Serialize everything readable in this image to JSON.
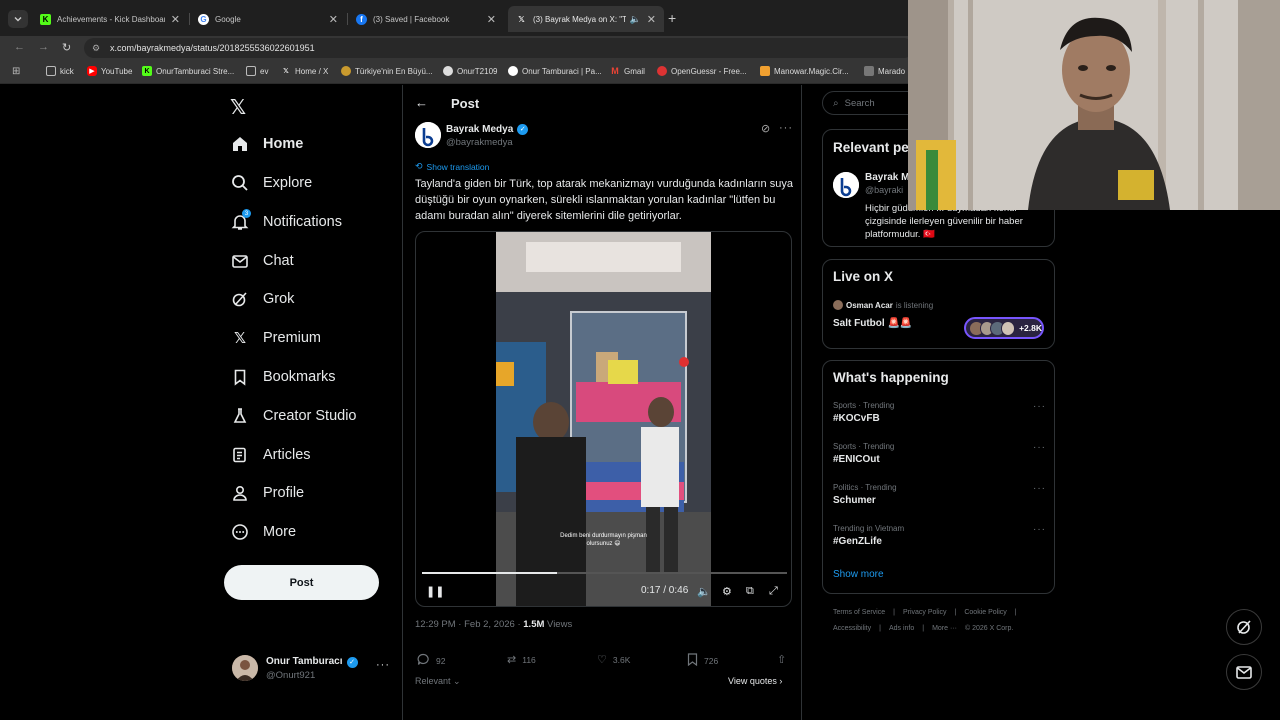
{
  "browser": {
    "tabs": [
      {
        "title": "Achievements - Kick Dashboard",
        "icon": "kick-icon",
        "color": "#53fc18"
      },
      {
        "title": "Google",
        "icon": "google-icon",
        "color": "#4285f4"
      },
      {
        "title": "(3) Saved | Facebook",
        "icon": "facebook-icon",
        "color": "#1877f2"
      },
      {
        "title": "(3) Bayrak Medya on X: \"Ta",
        "icon": "x-icon",
        "color": "#ffffff"
      }
    ],
    "new_tab": "+",
    "url": "x.com/bayrakmedya/status/2018255536022601951",
    "bookmarks": [
      {
        "label": "kick",
        "icon": "folder-icon"
      },
      {
        "label": "YouTube",
        "icon": "youtube-icon"
      },
      {
        "label": "OnurTamburaci Stre...",
        "icon": "kick-icon"
      },
      {
        "label": "ev",
        "icon": "folder-icon"
      },
      {
        "label": "Home / X",
        "icon": "x-icon"
      },
      {
        "label": "Türkiye'nin En Büyü...",
        "icon": "site-icon"
      },
      {
        "label": "OnurT2109",
        "icon": "site-icon"
      },
      {
        "label": "Onur Tamburaci | Pa...",
        "icon": "site-icon"
      },
      {
        "label": "Gmail",
        "icon": "gmail-icon"
      },
      {
        "label": "OpenGuessr - Free...",
        "icon": "site-icon"
      },
      {
        "label": "Manowar.Magic.Cir...",
        "icon": "site-icon"
      },
      {
        "label": "Marado",
        "icon": "site-icon"
      }
    ]
  },
  "nav": {
    "items": [
      {
        "label": "Home",
        "icon": "home-icon"
      },
      {
        "label": "Explore",
        "icon": "search-icon"
      },
      {
        "label": "Notifications",
        "icon": "bell-icon"
      },
      {
        "label": "Chat",
        "icon": "mail-icon"
      },
      {
        "label": "Grok",
        "icon": "grok-icon"
      },
      {
        "label": "Premium",
        "icon": "x-icon"
      },
      {
        "label": "Bookmarks",
        "icon": "bookmark-icon"
      },
      {
        "label": "Creator Studio",
        "icon": "flask-icon"
      },
      {
        "label": "Articles",
        "icon": "article-icon"
      },
      {
        "label": "Profile",
        "icon": "person-icon"
      },
      {
        "label": "More",
        "icon": "more-circle-icon"
      }
    ],
    "notifications_badge": "3",
    "post_button": "Post"
  },
  "account": {
    "name": "Onur Tamburacı",
    "handle": "@Onurt921"
  },
  "post": {
    "header": "Post",
    "author_name": "Bayrak Medya",
    "author_handle": "@bayrakmedya",
    "show_translation": "Show translation",
    "text": "Tayland'a giden bir Türk, top atarak mekanizmayı vurduğunda kadınların suya düştüğü bir oyun oynarken, sürekli ıslanmaktan yorulan kadınlar \"lütfen bu adamı buradan alın\" diyerek sitemlerini dile getiriyorlar.",
    "video": {
      "caption": "Dedim beni durdurmayın pişman olursunuz 😄",
      "time": "0:17 / 0:46",
      "progress": 0.37
    },
    "timestamp": "12:29 PM · Feb 2, 2026 · ",
    "views_count": "1.5M",
    "views_label": " Views",
    "stats": {
      "replies": "92",
      "reposts": "116",
      "likes": "3.6K",
      "bookmarks": "726"
    },
    "sort_label": "Relevant",
    "view_quotes": "View quotes"
  },
  "sidebar": {
    "search_placeholder": "Search",
    "relevant_people": {
      "title": "Relevant pe",
      "name": "Bayrak M",
      "handle": "@bayraki",
      "bio": "Hiçbir güdümleri ... duymadan kendi çizgisinde ilerleyen güvenilir bir haber platformudur. 🇹🇷"
    },
    "live": {
      "title": "Live on X",
      "host": "Osman Acar",
      "host_status": "is listening",
      "space": "Salt Futbol 🚨🚨",
      "listeners": "+2.8K"
    },
    "happening": {
      "title": "What's happening",
      "trends": [
        {
          "context": "Sports · Trending",
          "name": "#KOCvFB"
        },
        {
          "context": "Sports · Trending",
          "name": "#ENICOut"
        },
        {
          "context": "Politics · Trending",
          "name": "Schumer"
        },
        {
          "context": "Trending in Vietnam",
          "name": "#GenZLife"
        }
      ],
      "show_more": "Show more"
    },
    "footer": [
      "Terms of Service",
      "|",
      "Privacy Policy",
      "|",
      "Cookie Policy",
      "|",
      "Accessibility",
      "|",
      "Ads info",
      "|",
      "More ···",
      "© 2026 X Corp."
    ]
  },
  "colors": {
    "accent": "#1d9bf0",
    "background": "#000000",
    "text": "#e7e9ea",
    "muted": "#71767b",
    "border": "#2f3336",
    "live_ring": "#7856ff"
  }
}
